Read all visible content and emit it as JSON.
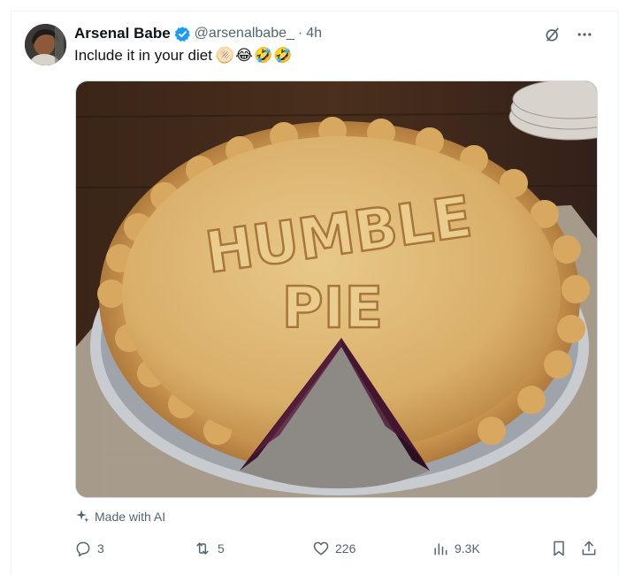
{
  "post": {
    "author_name": "Arsenal Babe",
    "handle": "@arsenalbabe_",
    "separator": "·",
    "time": "4h",
    "text": "Include it in your diet",
    "emojis": "🫓😂🤣🤣",
    "media_label": "Made with AI"
  },
  "image": {
    "pie_text_line1": "HUMBLE",
    "pie_text_line2": "PIE"
  },
  "actions": {
    "replies": "3",
    "reposts": "5",
    "likes": "226",
    "views": "9.3K"
  },
  "colors": {
    "verified": "#1d9bf0",
    "text": "#0f1419",
    "muted": "#536471"
  }
}
